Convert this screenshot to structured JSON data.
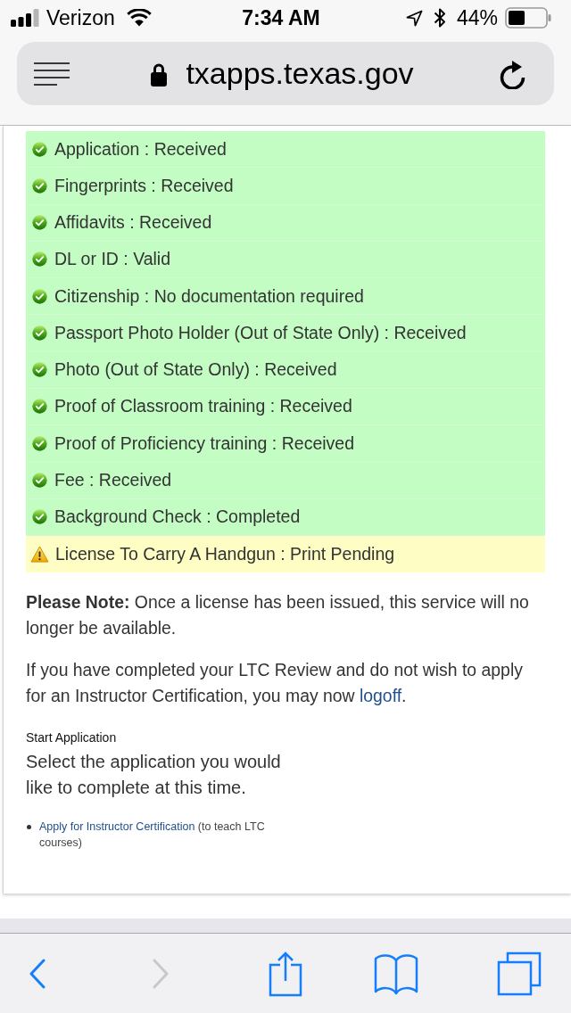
{
  "status_bar": {
    "carrier": "Verizon",
    "time": "7:34 AM",
    "battery": "44%"
  },
  "address_bar": {
    "url": "txapps.texas.gov"
  },
  "statuses": [
    {
      "kind": "complete",
      "text": "Application : Received"
    },
    {
      "kind": "complete",
      "text": "Fingerprints : Received"
    },
    {
      "kind": "complete",
      "text": "Affidavits : Received"
    },
    {
      "kind": "complete",
      "text": "DL or ID : Valid"
    },
    {
      "kind": "complete",
      "text": "Citizenship : No documentation required"
    },
    {
      "kind": "complete",
      "text": "Passport Photo Holder (Out of State Only) : Received"
    },
    {
      "kind": "complete",
      "text": "Photo (Out of State Only) : Received"
    },
    {
      "kind": "complete",
      "text": "Proof of Classroom training : Received"
    },
    {
      "kind": "complete",
      "text": "Proof of Proficiency training : Received"
    },
    {
      "kind": "complete",
      "text": "Fee : Received"
    },
    {
      "kind": "complete",
      "text": "Background Check : Completed"
    },
    {
      "kind": "pending",
      "text": "License To Carry A Handgun : Print Pending"
    }
  ],
  "note": {
    "text": "**Please Note:** Once a license has been issued, this service will no longer be available."
  },
  "logoff_notice": {
    "text": "If you have completed your LTC Review and do not wish to apply for an Instructor Certification, you may now",
    "link": "logoff",
    "after": "."
  },
  "start_application": {
    "heading": "Start Application",
    "prompt": "Select the application you would like to complete at this time.",
    "options": [
      {
        "link": "Apply for Instructor Certification",
        "note": "(to teach LTC courses)"
      }
    ]
  },
  "toolbar": [
    {
      "kind": "back",
      "disabled": false
    },
    {
      "kind": "forward",
      "disabled": true
    },
    {
      "kind": "share",
      "disabled": false
    },
    {
      "kind": "bookmarks",
      "disabled": false
    },
    {
      "kind": "tabs",
      "disabled": false
    }
  ]
}
